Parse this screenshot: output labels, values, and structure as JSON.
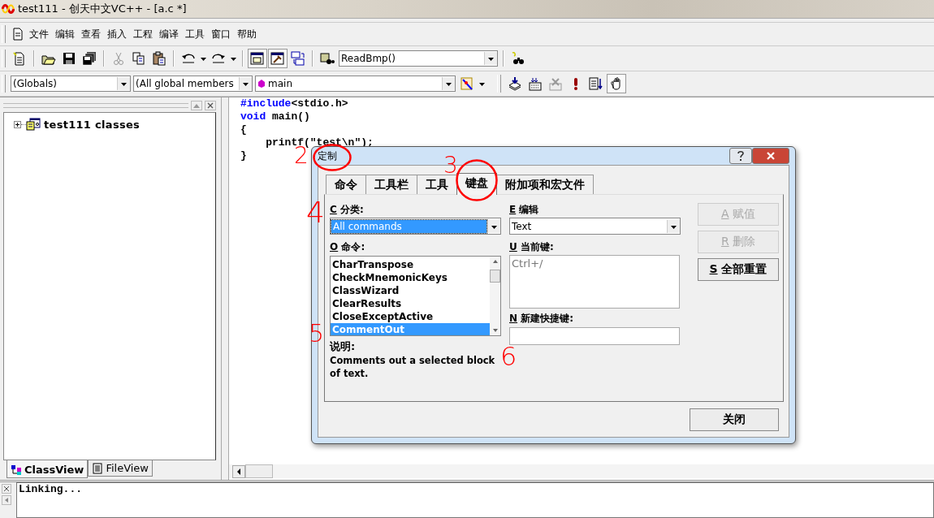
{
  "window": {
    "title": "test111 - 创天中文VC++ - [a.c *]"
  },
  "menu": {
    "items": [
      "文件",
      "编辑",
      "查看",
      "插入",
      "工程",
      "编译",
      "工具",
      "窗口",
      "帮助"
    ]
  },
  "toolbar": {
    "find_combo": "ReadBmp()"
  },
  "wizard_bar": {
    "scope_combo": "(Globals)",
    "filter_combo": "(All global members",
    "members_combo": "main"
  },
  "class_view": {
    "tree": [
      {
        "label": "test111 classes",
        "expanded": false
      }
    ]
  },
  "workspace_tabs": [
    {
      "label": "ClassView",
      "selected": true
    },
    {
      "label": "FileView",
      "selected": false
    }
  ],
  "editor": {
    "lines": [
      [
        {
          "text": "#include",
          "kind": "keyword"
        },
        {
          "text": "<stdio.h>",
          "kind": "plain"
        }
      ],
      [
        {
          "text": "void",
          "kind": "keyword"
        },
        {
          "text": " main()",
          "kind": "plain"
        }
      ],
      [
        {
          "text": "{",
          "kind": "plain"
        }
      ],
      [
        {
          "text": "    printf(\"test\\n\");",
          "kind": "plain"
        }
      ],
      [
        {
          "text": "}",
          "kind": "plain"
        }
      ]
    ]
  },
  "output": {
    "lines": [
      "Linking..."
    ]
  },
  "dialog": {
    "title": "定制",
    "tabs": [
      {
        "label": "命令",
        "selected": false
      },
      {
        "label": "工具栏",
        "selected": false
      },
      {
        "label": "工具",
        "selected": false
      },
      {
        "label": "键盘",
        "selected": true
      },
      {
        "label": "附加项和宏文件",
        "selected": false
      }
    ],
    "category": {
      "key": "C",
      "label": "分类:",
      "value": "All commands",
      "focused": true
    },
    "editor_combo": {
      "key": "E",
      "label": "编辑",
      "value": "Text"
    },
    "commands": {
      "key": "O",
      "label": "命令:",
      "items": [
        {
          "label": "CharTranspose",
          "selected": false
        },
        {
          "label": "CheckMnemonicKeys",
          "selected": false
        },
        {
          "label": "ClassWizard",
          "selected": false
        },
        {
          "label": "ClearResults",
          "selected": false
        },
        {
          "label": "CloseExceptActive",
          "selected": false
        },
        {
          "label": "CommentOut",
          "selected": true
        }
      ]
    },
    "description": {
      "label": "说明:",
      "text": "Comments out a selected block of text."
    },
    "current_keys": {
      "key": "U",
      "label": "当前键:",
      "items": [
        "Ctrl+/"
      ]
    },
    "new_shortcut": {
      "key": "N",
      "label": "新建快捷键:"
    },
    "buttons": [
      {
        "key": "A",
        "label": "赋值",
        "disabled": true
      },
      {
        "key": "R",
        "label": "删除",
        "disabled": true
      },
      {
        "key": "S",
        "label": "全部重置",
        "disabled": false
      }
    ],
    "close_button": "关闭"
  },
  "annotations": [
    {
      "label": "2",
      "circled": true
    },
    {
      "label": "3",
      "circled": true
    },
    {
      "label": "4",
      "circled": false
    },
    {
      "label": "5",
      "circled": false
    },
    {
      "label": "6",
      "circled": false
    }
  ]
}
